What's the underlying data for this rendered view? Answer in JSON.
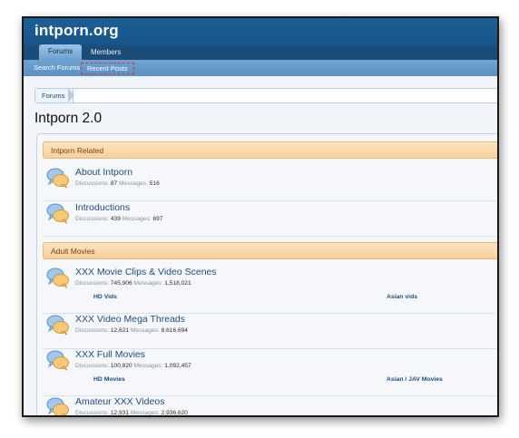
{
  "site": {
    "logo": "intporn.org"
  },
  "nav": {
    "tabs": [
      {
        "label": "Forums",
        "active": true
      },
      {
        "label": "Members",
        "active": false
      }
    ],
    "sub": [
      {
        "label": "Search Forums"
      },
      {
        "label": "Recent Posts"
      }
    ]
  },
  "breadcrumb": {
    "items": [
      "Forums"
    ]
  },
  "page": {
    "title": "Intporn 2.0"
  },
  "stat_labels": {
    "discussions": "Discussions:",
    "messages": "Messages:"
  },
  "categories": [
    {
      "name": "Intporn Related",
      "forums": [
        {
          "title": "About Intporn",
          "discussions": "87",
          "messages": "516",
          "subforums": []
        },
        {
          "title": "Introductions",
          "discussions": "439",
          "messages": "697",
          "subforums": []
        }
      ]
    },
    {
      "name": "Adult Movies",
      "forums": [
        {
          "title": "XXX Movie Clips & Video Scenes",
          "discussions": "745,906",
          "messages": "1,518,021",
          "subforums": [
            "HD Vids",
            "Asian vids"
          ]
        },
        {
          "title": "XXX Video Mega Threads",
          "discussions": "12,621",
          "messages": "8,616,694",
          "subforums": []
        },
        {
          "title": "XXX Full Movies",
          "discussions": "100,820",
          "messages": "1,092,457",
          "subforums": [
            "HD Movies",
            "Asian / JAV Movies"
          ]
        },
        {
          "title": "Amateur XXX Videos",
          "discussions": "12,931",
          "messages": "2,936,620",
          "subforums": []
        }
      ]
    }
  ],
  "icons": {
    "forum": "speech-bubbles-icon"
  },
  "colors": {
    "header": "#1d5f95",
    "category": "#f8d09b",
    "link": "#1e4d7f",
    "focus": "#d93a3a"
  }
}
